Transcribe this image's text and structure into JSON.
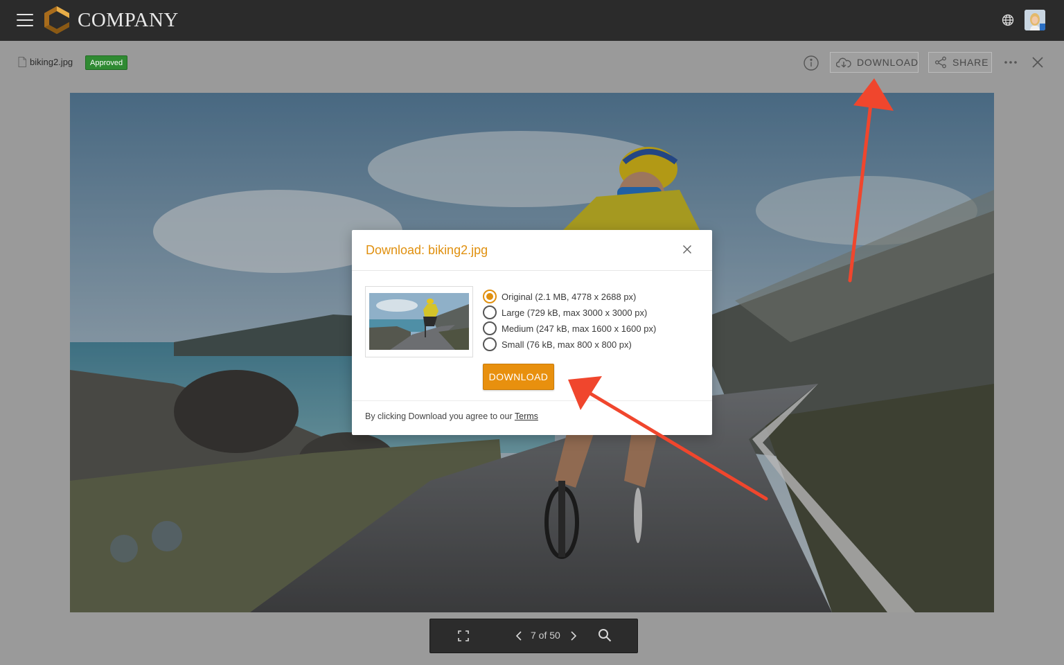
{
  "app": {
    "brand": "COMPANY",
    "menu_icon": "hamburger-icon",
    "logo": "company-c-logo"
  },
  "header": {
    "language_icon": "globe-icon",
    "avatar": "user-avatar"
  },
  "toolbar": {
    "file_name": "biking2.jpg",
    "status_badge": "Approved",
    "download_label": "DOWNLOAD",
    "share_label": "SHARE",
    "info_icon": "info-icon",
    "more_icon": "more-horizontal-icon",
    "close_icon": "close-icon"
  },
  "viewer": {
    "pager": "7 of 50"
  },
  "modal": {
    "title": "Download: biking2.jpg",
    "options": [
      {
        "label": "Original (2.1 MB, 4778 x 2688 px)",
        "selected": true
      },
      {
        "label": "Large (729 kB, max 3000 x 3000 px)",
        "selected": false
      },
      {
        "label": "Medium (247 kB, max 1600 x 1600 px)",
        "selected": false
      },
      {
        "label": "Small (76 kB, max 800 x 800 px)",
        "selected": false
      }
    ],
    "download_label": "DOWNLOAD",
    "agree_text": "By clicking Download you agree to our ",
    "terms_label": "Terms"
  },
  "colors": {
    "accent": "#e8900e",
    "topbar": "#2b2b2b",
    "badge": "#2f8a32",
    "annotation_arrow": "#f0462d"
  }
}
